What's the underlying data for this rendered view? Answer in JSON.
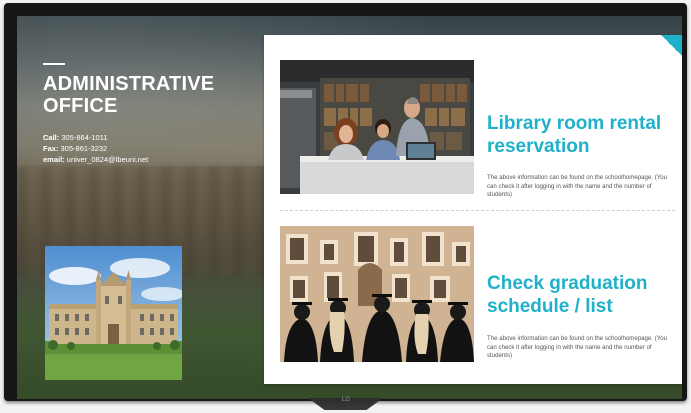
{
  "brand": {
    "logo_text": "LG"
  },
  "office": {
    "title": "ADMINISTRATIVE OFFICE",
    "call_label": "Call:",
    "call_value": " 305-864-1011",
    "fax_label": "Fax:",
    "fax_value": " 305-861-3232",
    "email_label": "email:",
    "email_value": " univer_0824@lbeuni.net"
  },
  "sections": [
    {
      "title": "Library room rental reservation",
      "description": "The above information can be found on the schoolhomepage. (You can check it after logging in with the name and the number of students)",
      "photo_icon": "library-study-photo"
    },
    {
      "title": "Check graduation schedule / list",
      "description": "The above information can be found on the schoolhomepage. (You can check it after logging in with the name and the number of students)",
      "photo_icon": "graduation-ceremony-photo"
    }
  ],
  "colors": {
    "accent": "#1fb1c9",
    "card_background": "#ffffff",
    "tv_bezel": "#161616"
  }
}
